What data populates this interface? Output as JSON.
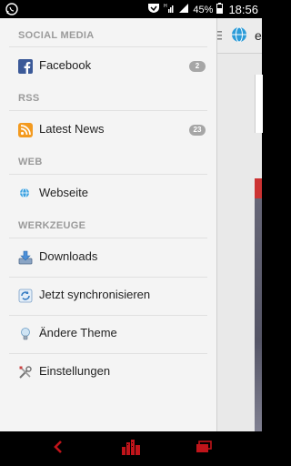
{
  "status": {
    "battery": "45%",
    "time": "18:56"
  },
  "behind": {
    "title_fragment": "e"
  },
  "drawer": {
    "sections": [
      {
        "header": "SOCIAL MEDIA",
        "items": [
          {
            "label": "Facebook",
            "icon": "facebook-icon",
            "badge": "2"
          }
        ]
      },
      {
        "header": "RSS",
        "items": [
          {
            "label": "Latest News",
            "icon": "rss-icon",
            "badge": "23"
          }
        ]
      },
      {
        "header": "WEB",
        "items": [
          {
            "label": "Webseite",
            "icon": "globe-icon"
          }
        ]
      },
      {
        "header": "WERKZEUGE",
        "items": [
          {
            "label": "Downloads",
            "icon": "download-icon"
          },
          {
            "label": "Jetzt synchronisieren",
            "icon": "sync-icon"
          },
          {
            "label": "Ändere Theme",
            "icon": "lightbulb-icon"
          },
          {
            "label": "Einstellungen",
            "icon": "tools-icon"
          }
        ]
      }
    ]
  },
  "colors": {
    "nav_accent": "#c0141a",
    "drawer_bg": "#f4f4f4"
  }
}
